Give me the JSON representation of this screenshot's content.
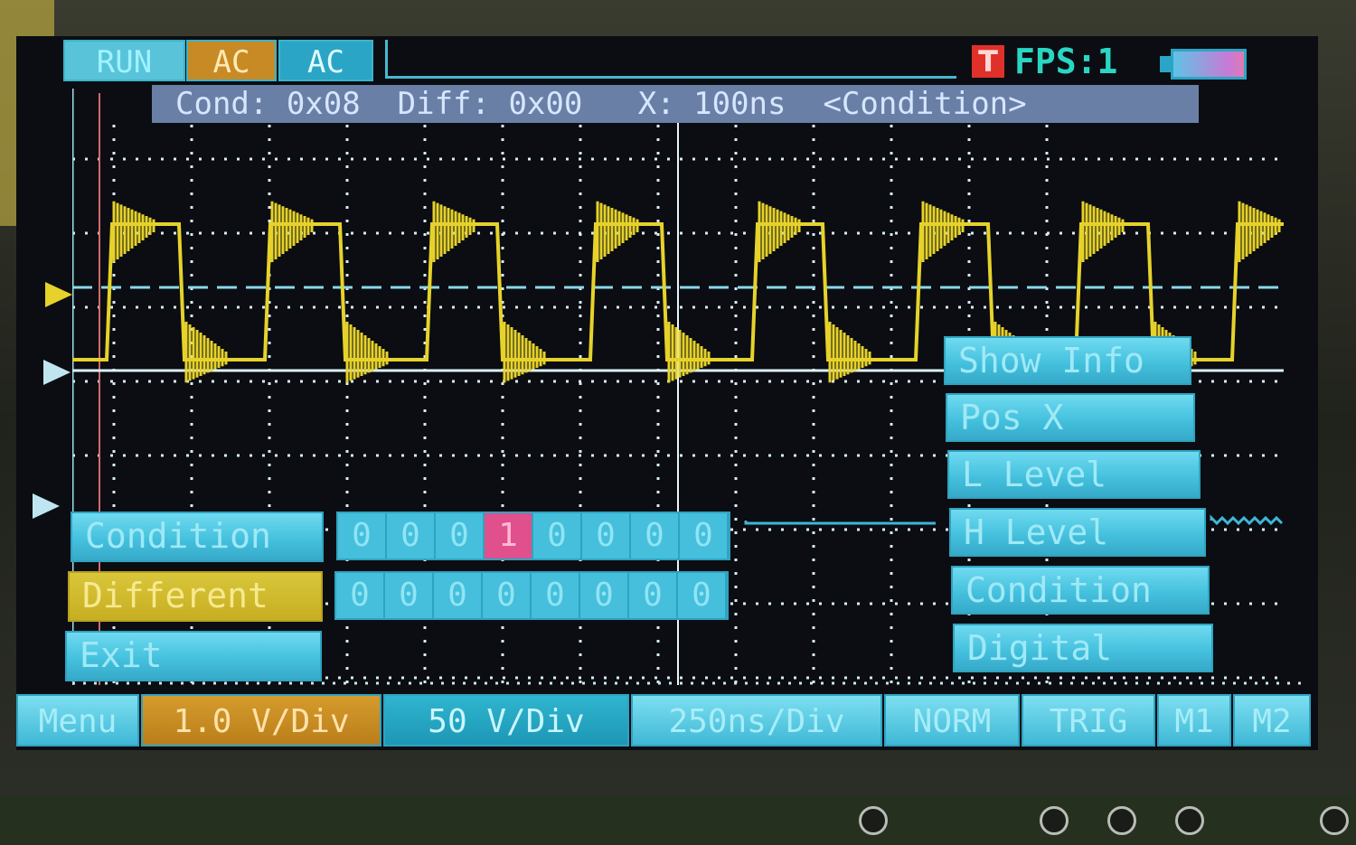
{
  "topbar": {
    "run_label": "RUN",
    "ch1_coupling": "AC",
    "ch2_coupling": "AC",
    "trigger_indicator": "T",
    "fps": "FPS:1"
  },
  "infobar": {
    "text": "Cond: 0x08  Diff: 0x00   X: 100ns  <Condition>"
  },
  "left_menu": {
    "condition": "Condition",
    "different": "Different",
    "exit": "Exit"
  },
  "condition_bits": [
    "0",
    "0",
    "0",
    "1",
    "0",
    "0",
    "0",
    "0"
  ],
  "different_bits": [
    "0",
    "0",
    "0",
    "0",
    "0",
    "0",
    "0",
    "0"
  ],
  "right_menu": {
    "items": [
      "Show Info",
      "Pos X",
      "L Level",
      "H Level",
      "Condition",
      "Digital"
    ]
  },
  "bottombar": {
    "menu": "Menu",
    "ch1_scale": "1.0 V/Div",
    "ch2_scale": "50 V/Div",
    "timebase": "250ns/Div",
    "trigger_mode": "NORM",
    "trig": "TRIG",
    "m1": "M1",
    "m2": "M2"
  },
  "colors": {
    "trace_ch1": "#e6d22a",
    "trace_ch2": "#3fb6d6",
    "grid": "#d8ecf4",
    "button_cyan": "#42bfdc",
    "button_orange": "#c88a24",
    "highlight_bit": "#e0508c"
  }
}
